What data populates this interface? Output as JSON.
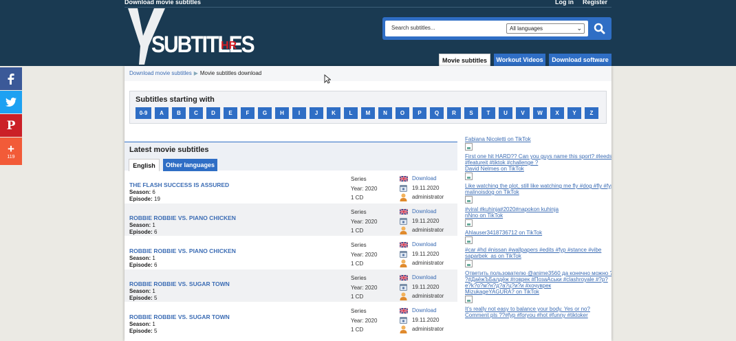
{
  "header": {
    "tagline": "Download movie subtitles",
    "login": "Log in",
    "register": "Register",
    "logo_text": "SUBTITLES",
    "logo_suffix": "HR",
    "search_placeholder": "Search subtitles...",
    "language_selected": "All languages",
    "tabs": [
      "Movie subtitles",
      "Workout Videos",
      "Download software"
    ]
  },
  "social": {
    "plus_count": "119"
  },
  "breadcrumb": {
    "home": "Download movie subtitles",
    "current": "Movie subtitles download"
  },
  "letters": {
    "title": "Subtitles starting with",
    "items": [
      "0-9",
      "A",
      "B",
      "C",
      "D",
      "E",
      "F",
      "G",
      "H",
      "I",
      "J",
      "K",
      "L",
      "M",
      "N",
      "O",
      "P",
      "Q",
      "R",
      "S",
      "T",
      "U",
      "V",
      "W",
      "X",
      "Y",
      "Z"
    ]
  },
  "latest": {
    "title": "Latest movie subtitles",
    "tabs": [
      "English",
      "Other languages"
    ],
    "rows": [
      {
        "name": "THE FLASH SUCCESS IS ASSURED",
        "season": "6",
        "episode": "19",
        "type": "Series",
        "year": "Year: 2020",
        "cd": "1 CD",
        "download": "Download",
        "date": "19.11.2020",
        "user": "administrator"
      },
      {
        "name": "ROBBIE ROBBIE VS. PIANO CHICKEN",
        "season": "1",
        "episode": "6",
        "type": "Series",
        "year": "Year: 2020",
        "cd": "1 CD",
        "download": "Download",
        "date": "19.11.2020",
        "user": "administrator"
      },
      {
        "name": "ROBBIE ROBBIE VS. PIANO CHICKEN",
        "season": "1",
        "episode": "6",
        "type": "Series",
        "year": "Year: 2020",
        "cd": "1 CD",
        "download": "Download",
        "date": "19.11.2020",
        "user": "administrator"
      },
      {
        "name": "ROBBIE ROBBIE VS. SUGAR TOWN",
        "season": "1",
        "episode": "5",
        "type": "Series",
        "year": "Year: 2020",
        "cd": "1 CD",
        "download": "Download",
        "date": "19.11.2020",
        "user": "administrator"
      },
      {
        "name": "ROBBIE ROBBIE VS. SUGAR TOWN",
        "season": "1",
        "episode": "5",
        "type": "Series",
        "year": "Year: 2020",
        "cd": "1 CD",
        "download": "Download",
        "date": "19.11.2020",
        "user": "administrator"
      }
    ],
    "season_label": "Season:",
    "episode_label": "Episode:"
  },
  "sidebar": {
    "items": [
      {
        "lines": [
          "Fabiana Nicoletti on TikTok"
        ],
        "img": true
      },
      {
        "lines": [
          "First one hit HARD?? Can you guys name this sport? #leeds",
          "#featureit #tiktok #challenge ?",
          "David Nelmes on TikTok"
        ],
        "img": true
      },
      {
        "lines": [
          "Like watching the plot, still like watching me fly #dog #fly #fyp",
          "malinoisdog on TikTok"
        ],
        "img": true
      },
      {
        "lines": [
          "#viral #kuhinja#2020#napokon kuhinja",
          "nNno on TikTok"
        ],
        "img": true
      },
      {
        "lines": [
          "Ahlauser3418736712 on TikTok"
        ],
        "img": true
      },
      {
        "lines": [
          "#car #hd #nissan #wallpapers #edits #fyp #stance #vibe",
          "saparbek_as on TikTok"
        ],
        "img": true
      },
      {
        "lines": [
          "Ответить пользователю @anime3560 да конечно можно ?",
          "?#ДаёжЪБалдёж #говрек #ПозаАськи #clashroyale #?p?",
          "e?k?o?м?н?д?а?ц?и?и #хочуврек",
          "MizukageYAGURA? on TikTok"
        ],
        "img": true
      },
      {
        "lines": [
          "It's really not easy to balance your body. Yes or no?",
          "Comment pls ??#fyp #foryou #hot #funny #tiktoker"
        ],
        "img": false
      }
    ]
  },
  "colors": {
    "header_bg": "#1a3a52",
    "accent": "#2f6ec5",
    "link": "#3b6cb4",
    "logo_red": "#d41f26"
  }
}
